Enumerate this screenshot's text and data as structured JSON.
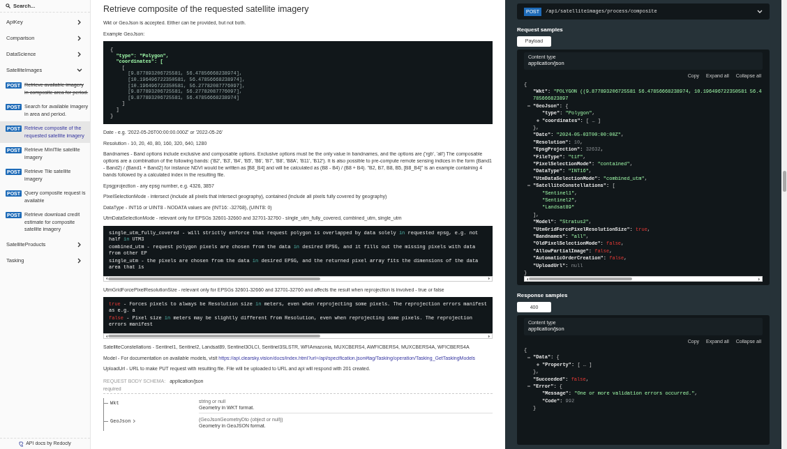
{
  "sidebar": {
    "search": {
      "placeholder": "Search..."
    },
    "items": [
      {
        "label": "ApiKey",
        "expanded": false
      },
      {
        "label": "Comparison",
        "expanded": false
      },
      {
        "label": "DataScience",
        "expanded": false
      },
      {
        "label": "SatelliteImages",
        "expanded": true,
        "children": [
          {
            "method": "POST",
            "label": "Retrieve available imagery in composite area for period.",
            "deprecated": true,
            "selected": false
          },
          {
            "method": "POST",
            "label": "Search for available imagery in area and period.",
            "deprecated": false,
            "selected": false
          },
          {
            "method": "POST",
            "label": "Retrieve composite of the requested satellite imagery",
            "deprecated": false,
            "selected": true
          },
          {
            "method": "POST",
            "label": "Retrieve MiniTile satellite imagery",
            "deprecated": false,
            "selected": false
          },
          {
            "method": "POST",
            "label": "Retrieve Tile satellite imagery",
            "deprecated": false,
            "selected": false
          },
          {
            "method": "POST",
            "label": "Query composite request is available",
            "deprecated": false,
            "selected": false
          },
          {
            "method": "POST",
            "label": "Retrieve download credit estimate for composite satellite imagery",
            "deprecated": false,
            "selected": false
          }
        ]
      },
      {
        "label": "SatelliteProducts",
        "expanded": false
      },
      {
        "label": "Tasking",
        "expanded": false
      }
    ],
    "footer": "API docs by Redocly"
  },
  "operation": {
    "title": "Retrieve composite of the requested satellite imagery",
    "blocks": [
      {
        "kind": "paragraph",
        "text": "Wkt or GeoJson is accepted. Either can be provided, but not both."
      },
      {
        "kind": "paragraph",
        "text": "Example GeoJson:"
      },
      {
        "kind": "code",
        "scrollbar": false,
        "lines": [
          [
            {
              "t": "{",
              "kind": "punct"
            }
          ],
          [
            {
              "t": "  \"type\": \"Polygon\",",
              "kind": "key"
            }
          ],
          [
            {
              "t": "  \"coordinates\": [",
              "kind": "key"
            }
          ],
          [
            {
              "t": "    [",
              "kind": "punct"
            }
          ],
          [
            {
              "t": "      [9.877893206725581, 56.47856668238974],",
              "kind": "number"
            }
          ],
          [
            {
              "t": "      [10.196496722350581, 56.47856668238974],",
              "kind": "number"
            }
          ],
          [
            {
              "t": "      [10.196496722350581, 56.27782087776097],",
              "kind": "number"
            }
          ],
          [
            {
              "t": "      [9.877893206725581, 56.27782087776097],",
              "kind": "number"
            }
          ],
          [
            {
              "t": "      [9.877893206725581, 56.47856668238974]",
              "kind": "number"
            }
          ],
          [
            {
              "t": "    ]",
              "kind": "punct"
            }
          ],
          [
            {
              "t": "  ]",
              "kind": "punct"
            }
          ],
          [
            {
              "t": "}",
              "kind": "punct"
            }
          ]
        ]
      },
      {
        "kind": "paragraph",
        "text": "Date - e.g. '2022-05-26T00:00:00.000Z' or '2022-05-26'"
      },
      {
        "kind": "paragraph",
        "text": "Resolution - 10, 20, 40, 80, 160, 320, 640, 1280"
      },
      {
        "kind": "paragraph",
        "text": "Bandnames - Band options include exclusive and composable options. Exclusive options must be the only value in bandnames, and the options are ('rgb', 'all') The composable options are a combination of the following bands: ('B2', 'B3', 'B4', 'B5', 'B6', 'B7', 'B8', 'B8A', 'B11', 'B12'). It is also possible to pre-compute remote sensing indices in the form (Band1 - Band2) / (Band1 + Band2) for instance NDVI would be written as [B8_B4] and will be calculated as (B8 - B4) / (B8 + B4). \"B2, B7, B8, B5, [B8_B4]\" is an example containing 4 bands followed by a calculated index in the resulting file."
      },
      {
        "kind": "paragraph",
        "text": "Epsgprojection - any epsg number, e.g. 4326, 3857"
      },
      {
        "kind": "paragraph",
        "text": "PixelSelectionMode - intersect (include all pixels that intersect geography), contained (include all pixels fully covered by geography)"
      },
      {
        "kind": "paragraph",
        "text": "DataType - INT16 or UINT8 - NODATA values are (INT16: -32768), (UINT8: 0)"
      },
      {
        "kind": "paragraph",
        "text": "UtmDataSelectionMode - relevant only for EPSGs 32601-32660 and 32701-32760 - single_utm_fully_covered, combined_utm, single_utm"
      },
      {
        "kind": "code",
        "scrollbar": true,
        "lines": [
          [
            {
              "t": "single_utm_fully_covered - will strictly enforce that request polygon is overlapped by data solely ",
              "kind": "plain"
            },
            {
              "t": "in",
              "kind": "keyword"
            },
            {
              "t": " requested epsg, e.g. not half ",
              "kind": "plain"
            },
            {
              "t": "in",
              "kind": "keyword"
            },
            {
              "t": " UTM3",
              "kind": "plain"
            }
          ],
          [
            {
              "t": "combined_utm - request polygon pixels are chosen from the data ",
              "kind": "plain"
            },
            {
              "t": "in",
              "kind": "keyword"
            },
            {
              "t": " desired EPSG, and it fills out the missing pixels with data from other EP",
              "kind": "plain"
            }
          ],
          [
            {
              "t": "single_utm - the pixels are chosen from the data ",
              "kind": "plain"
            },
            {
              "t": "in",
              "kind": "keyword"
            },
            {
              "t": " desired EPSG, and the returned pixel array fits the dimensions of the data area that is",
              "kind": "plain"
            }
          ]
        ]
      },
      {
        "kind": "paragraph",
        "text": "UtmGridForcePixelResolutionSize - relevant only for EPSGs 32601-32660 and 32701-32760 and affects the result when reprojection is involved - true or false"
      },
      {
        "kind": "code",
        "scrollbar": true,
        "lines": [
          [
            {
              "t": "true",
              "kind": "literal"
            },
            {
              "t": " - Forces pixels to always be Resolution size ",
              "kind": "plain"
            },
            {
              "t": "in",
              "kind": "keyword"
            },
            {
              "t": " meters, even when reprojecting some pixels. The reprojection errors manifest as e.g. a",
              "kind": "plain"
            }
          ],
          [
            {
              "t": "false",
              "kind": "literal"
            },
            {
              "t": " - Pixel size ",
              "kind": "plain"
            },
            {
              "t": "in",
              "kind": "keyword"
            },
            {
              "t": " meters may be slightly different from Resolution, even when reprojecting some pixels. The reprojection errors manifest",
              "kind": "plain"
            }
          ]
        ]
      },
      {
        "kind": "paragraph",
        "text": "SatelliteConstellations - Sentinel1, Sentinel2, Landsat89, Sentinel3OLCI, Sentinel3SLSTR, WFIAmazonia, MUXCBERS4, AWFICBERS4, MUXCBERS4A, WFICBERS4A"
      },
      {
        "kind": "paragraph",
        "text": "Model - For documentation on available models, visit ",
        "link": "https://api.clearsky.vision/docs/index.html?url=/api/specification.json#tag/Tasking/operation/Tasking_GetTaskingModels"
      },
      {
        "kind": "paragraph",
        "text": "UploadUrl - URL to make PUT request with resulting file. File will be uploaded to URL and api will respond with 201 created."
      }
    ],
    "schema": {
      "label": "REQUEST BODY SCHEMA:",
      "content_type": "application/json",
      "required": "required",
      "fields": [
        {
          "name": "Wkt",
          "expandable": false,
          "type": "string or null",
          "description": "Geometry in WKT format."
        },
        {
          "name": "GeoJson",
          "expandable": true,
          "type": "(GeoJsonGeometryDto (object or null))",
          "description": "Geometry in GeoJSON format."
        }
      ]
    }
  },
  "endpoint": {
    "method": "POST",
    "path": "/api/satelliteimages/process/composite",
    "expanded": false
  },
  "samples": [
    {
      "heading": "Request samples",
      "tabs": [
        {
          "label": "Payload",
          "selected": true
        }
      ],
      "content_type_label": "Content type",
      "content_type": "application/json",
      "actions": [
        "Copy",
        "Expand all",
        "Collapse all"
      ],
      "scrollbar": true,
      "tree": {
        "open": "{",
        "close": "}",
        "items": [
          {
            "k": "\"Wkt\":",
            "v": "\"POLYGON ((9.877893206725581 56.47856668238974, 10.196496722350581 56.4785666823897",
            "kind": "string"
          },
          {
            "k": "\"GeoJson\":",
            "open": "{",
            "close": "},",
            "expanded": true,
            "items": [
              {
                "k": "\"type\":",
                "v": "\"Polygon\"",
                "p": ",",
                "kind": "string"
              },
              {
                "k": "\"coordinates\":",
                "open": "[",
                "ellipsis": "…",
                "close": "]",
                "expanded": false
              }
            ]
          },
          {
            "k": "\"Date\":",
            "v": "\"2024-05-03T00:00:00Z\"",
            "p": ",",
            "kind": "string"
          },
          {
            "k": "\"Resolution\":",
            "v": "10",
            "p": ",",
            "kind": "number"
          },
          {
            "k": "\"EpsgProjection\":",
            "v": "32632",
            "p": ",",
            "kind": "number"
          },
          {
            "k": "\"FileType\":",
            "v": "\"tif\"",
            "p": ",",
            "kind": "string"
          },
          {
            "k": "\"PixelSelectionMode\":",
            "v": "\"contained\"",
            "p": ",",
            "kind": "string"
          },
          {
            "k": "\"DataType\":",
            "v": "\"INT16\"",
            "p": ",",
            "kind": "string"
          },
          {
            "k": "\"UtmDataSelectionMode\":",
            "v": "\"combined_utm\"",
            "p": ",",
            "kind": "string"
          },
          {
            "k": "\"SatelliteConstellations\":",
            "open": "[",
            "close": "],",
            "expanded": true,
            "items": [
              {
                "v": "\"Sentinel1\"",
                "p": ",",
                "kind": "string"
              },
              {
                "v": "\"Sentinel2\"",
                "p": ",",
                "kind": "string"
              },
              {
                "v": "\"Landsat89\"",
                "kind": "string"
              }
            ]
          },
          {
            "k": "\"Model\":",
            "v": "\"Stratus2\"",
            "p": ",",
            "kind": "string"
          },
          {
            "k": "\"UtmGridForcePixelResolutionSize\":",
            "v": "true",
            "p": ",",
            "kind": "boolean"
          },
          {
            "k": "\"Bandnames\":",
            "v": "\"all\"",
            "p": ",",
            "kind": "string"
          },
          {
            "k": "\"OldPixelSelectionMode\":",
            "v": "false",
            "p": ",",
            "kind": "boolean"
          },
          {
            "k": "\"AllowPartialImage\":",
            "v": "false",
            "p": ",",
            "kind": "boolean"
          },
          {
            "k": "\"AutomaticOrderCreation\":",
            "v": "false",
            "p": ",",
            "kind": "boolean"
          },
          {
            "k": "\"UploadUrl\":",
            "v": "null",
            "kind": "null"
          }
        ]
      }
    },
    {
      "heading": "Response samples",
      "tabs": [
        {
          "label": "400",
          "selected": true
        }
      ],
      "content_type_label": "Content type",
      "content_type": "application/json",
      "actions": [
        "Copy",
        "Expand all",
        "Collapse all"
      ],
      "scrollbar": false,
      "tree": {
        "open": "{",
        "items": [
          {
            "k": "\"Data\":",
            "open": "{",
            "close": "},",
            "expanded": true,
            "items": [
              {
                "k": "\"Property\":",
                "open": "[",
                "ellipsis": "…",
                "close": "]",
                "expanded": false
              }
            ]
          },
          {
            "k": "\"Succeeded\":",
            "v": "false",
            "p": ",",
            "kind": "boolean"
          },
          {
            "k": "\"Error\":",
            "open": "{",
            "close": "}",
            "expanded": true,
            "items": [
              {
                "k": "\"Message\":",
                "v": "\"One or more validation errors occurred.\"",
                "p": ",",
                "kind": "string"
              },
              {
                "k": "\"Code\":",
                "v": "992",
                "kind": "number"
              }
            ]
          }
        ]
      }
    }
  ]
}
